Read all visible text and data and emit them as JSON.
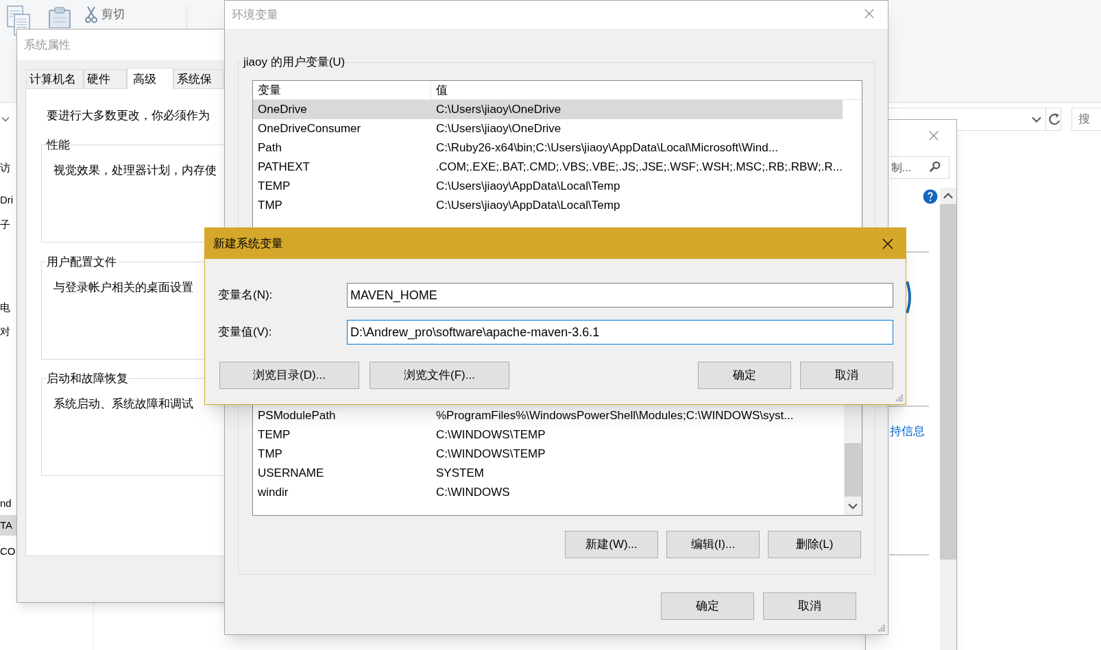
{
  "explorer": {
    "ribbon": [
      {
        "label": "剪切"
      }
    ],
    "nav": [
      {
        "label": "访",
        "selected": false
      },
      {
        "label": "Dri",
        "selected": false
      },
      {
        "label": "子",
        "selected": false
      },
      {
        "label": "电",
        "selected": false
      },
      {
        "label": "对",
        "selected": false
      },
      {
        "label": "nd",
        "selected": false
      },
      {
        "label": "TA",
        "selected": true
      },
      {
        "label": "CO",
        "selected": false
      }
    ],
    "search_placeholder": "搜"
  },
  "control_panel": {
    "search_placeholder": "制...",
    "link": "持信息"
  },
  "system_properties": {
    "title": "系统属性",
    "tabs": [
      {
        "label": "计算机名",
        "selected": false
      },
      {
        "label": "硬件",
        "selected": false
      },
      {
        "label": "高级",
        "selected": true
      },
      {
        "label": "系统保",
        "selected": false
      }
    ],
    "intro": "要进行大多数更改，你必须作为",
    "groups": [
      {
        "title": "性能",
        "text": "视觉效果，处理器计划，内存使"
      },
      {
        "title": "用户配置文件",
        "text": "与登录帐户相关的桌面设置"
      },
      {
        "title": "启动和故障恢复",
        "text": "系统启动、系统故障和调试"
      }
    ]
  },
  "environment_variables": {
    "title": "环境变量",
    "user_group": "jiaoy 的用户变量(U)",
    "user_columns": [
      "变量",
      "值"
    ],
    "user_rows": [
      {
        "name": "OneDrive",
        "value": "C:\\Users\\jiaoy\\OneDrive",
        "selected": true
      },
      {
        "name": "OneDriveConsumer",
        "value": "C:\\Users\\jiaoy\\OneDrive",
        "selected": false
      },
      {
        "name": "Path",
        "value": "C:\\Ruby26-x64\\bin;C:\\Users\\jiaoy\\AppData\\Local\\Microsoft\\Wind...",
        "selected": false
      },
      {
        "name": "PATHEXT",
        "value": ".COM;.EXE;.BAT;.CMD;.VBS;.VBE;.JS;.JSE;.WSF;.WSH;.MSC;.RB;.RBW;.R...",
        "selected": false
      },
      {
        "name": "TEMP",
        "value": "C:\\Users\\jiaoy\\AppData\\Local\\Temp",
        "selected": false
      },
      {
        "name": "TMP",
        "value": "C:\\Users\\jiaoy\\AppData\\Local\\Temp",
        "selected": false
      }
    ],
    "system_rows": [
      {
        "name": "PSModulePath",
        "value": "%ProgramFiles%\\WindowsPowerShell\\Modules;C:\\WINDOWS\\syst..."
      },
      {
        "name": "TEMP",
        "value": "C:\\WINDOWS\\TEMP"
      },
      {
        "name": "TMP",
        "value": "C:\\WINDOWS\\TEMP"
      },
      {
        "name": "USERNAME",
        "value": "SYSTEM"
      },
      {
        "name": "windir",
        "value": "C:\\WINDOWS"
      }
    ],
    "system_buttons": [
      "新建(W)...",
      "编辑(I)...",
      "删除(L)"
    ],
    "buttons": [
      "确定",
      "取消"
    ]
  },
  "new_variable_dialog": {
    "title": "新建系统变量",
    "fields": [
      {
        "label": "变量名(N):",
        "value": "MAVEN_HOME",
        "focused": false
      },
      {
        "label": "变量值(V):",
        "value": "D:\\Andrew_pro\\software\\apache-maven-3.6.1",
        "focused": true
      }
    ],
    "buttons": [
      "浏览目录(D)...",
      "浏览文件(F)...",
      "确定",
      "取消"
    ]
  }
}
